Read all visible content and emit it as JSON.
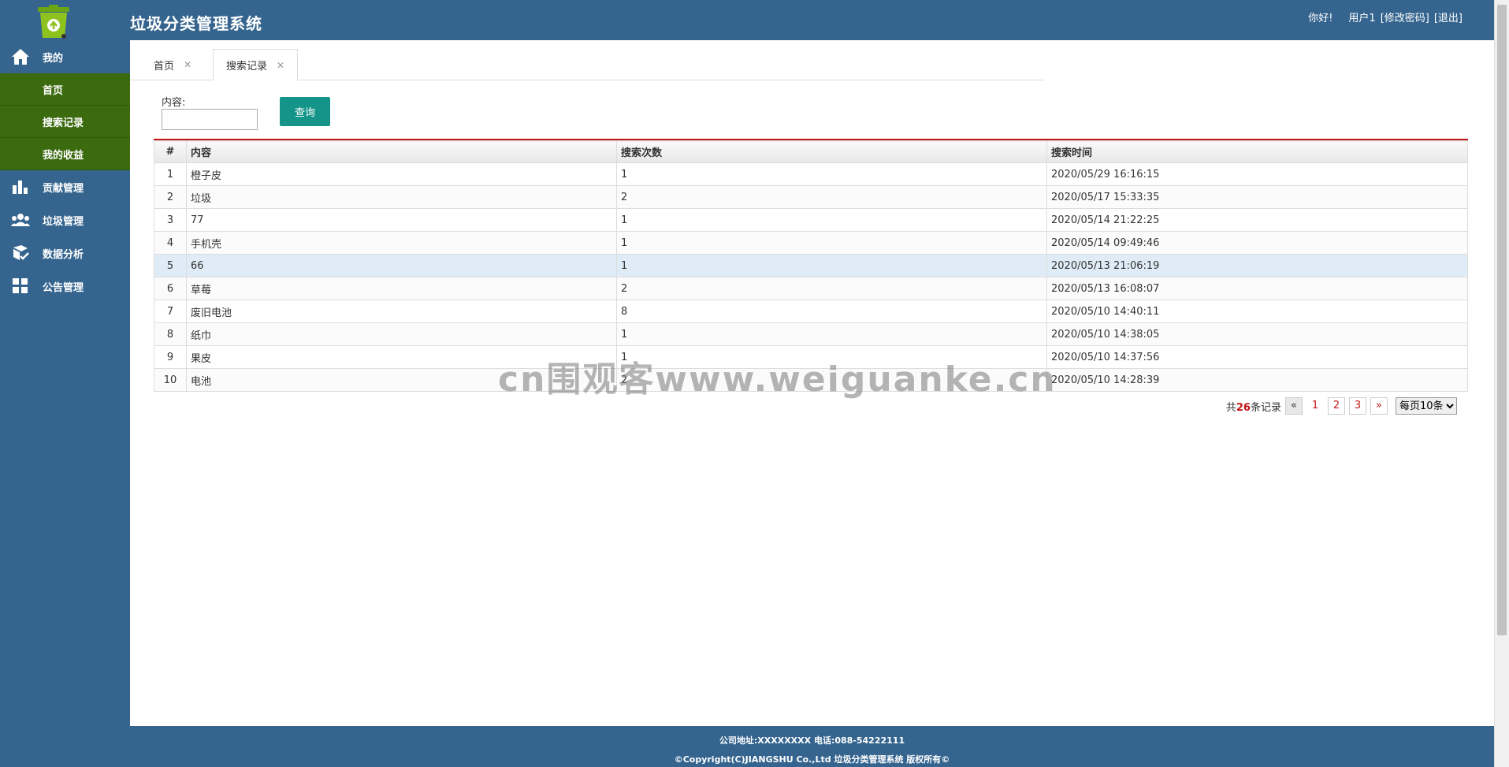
{
  "header": {
    "title": "垃圾分类管理系统",
    "greeting": "你好!",
    "username": "用户1",
    "change_password": "[修改密码]",
    "logout": "[退出]"
  },
  "sidebar": {
    "groups": [
      {
        "label": "我的",
        "icon": "home-icon"
      },
      {
        "label": "贡献管理",
        "icon": "bar-chart-icon"
      },
      {
        "label": "垃圾管理",
        "icon": "users-icon"
      },
      {
        "label": "数据分析",
        "icon": "analysis-icon"
      },
      {
        "label": "公告管理",
        "icon": "grid-icon"
      }
    ],
    "sub_items": [
      "首页",
      "搜索记录",
      "我的收益"
    ]
  },
  "tabs": [
    {
      "label": "首页",
      "close": "✕"
    },
    {
      "label": "搜索记录",
      "close": "✕"
    }
  ],
  "search": {
    "label": "内容:",
    "value": "",
    "placeholder": "",
    "button": "查询"
  },
  "table": {
    "columns": [
      "#",
      "内容",
      "搜索次数",
      "搜索时间"
    ],
    "rows": [
      [
        "1",
        "橙子皮",
        "1",
        "2020/05/29 16:16:15"
      ],
      [
        "2",
        "垃圾",
        "2",
        "2020/05/17 15:33:35"
      ],
      [
        "3",
        "77",
        "1",
        "2020/05/14 21:22:25"
      ],
      [
        "4",
        "手机壳",
        "1",
        "2020/05/14 09:49:46"
      ],
      [
        "5",
        "66",
        "1",
        "2020/05/13 21:06:19"
      ],
      [
        "6",
        "草莓",
        "2",
        "2020/05/13 16:08:07"
      ],
      [
        "7",
        "废旧电池",
        "8",
        "2020/05/10 14:40:11"
      ],
      [
        "8",
        "纸巾",
        "1",
        "2020/05/10 14:38:05"
      ],
      [
        "9",
        "果皮",
        "1",
        "2020/05/10 14:37:56"
      ],
      [
        "10",
        "电池",
        "2",
        "2020/05/10 14:28:39"
      ]
    ],
    "highlighted_row": 5
  },
  "pager": {
    "prefix": "共",
    "total": "26",
    "suffix": "条记录",
    "prev": "«",
    "pages": [
      "1",
      "2",
      "3"
    ],
    "next": "»",
    "page_size": "每页10条"
  },
  "footer": {
    "line1": "公司地址:XXXXXXXX 电话:088-54222111",
    "line2": "©Copyright(C)JIANGSHU Co.,Ltd 垃圾分类管理系统 版权所有©"
  },
  "watermark": "cn围观客www.weiguanke.cn",
  "colors": {
    "header_bg": "#35658f",
    "submenu_bg": "#3b6a0f",
    "button_bg": "#15958a",
    "accent_red": "#c01414",
    "highlight_row": "#dfecf7"
  }
}
